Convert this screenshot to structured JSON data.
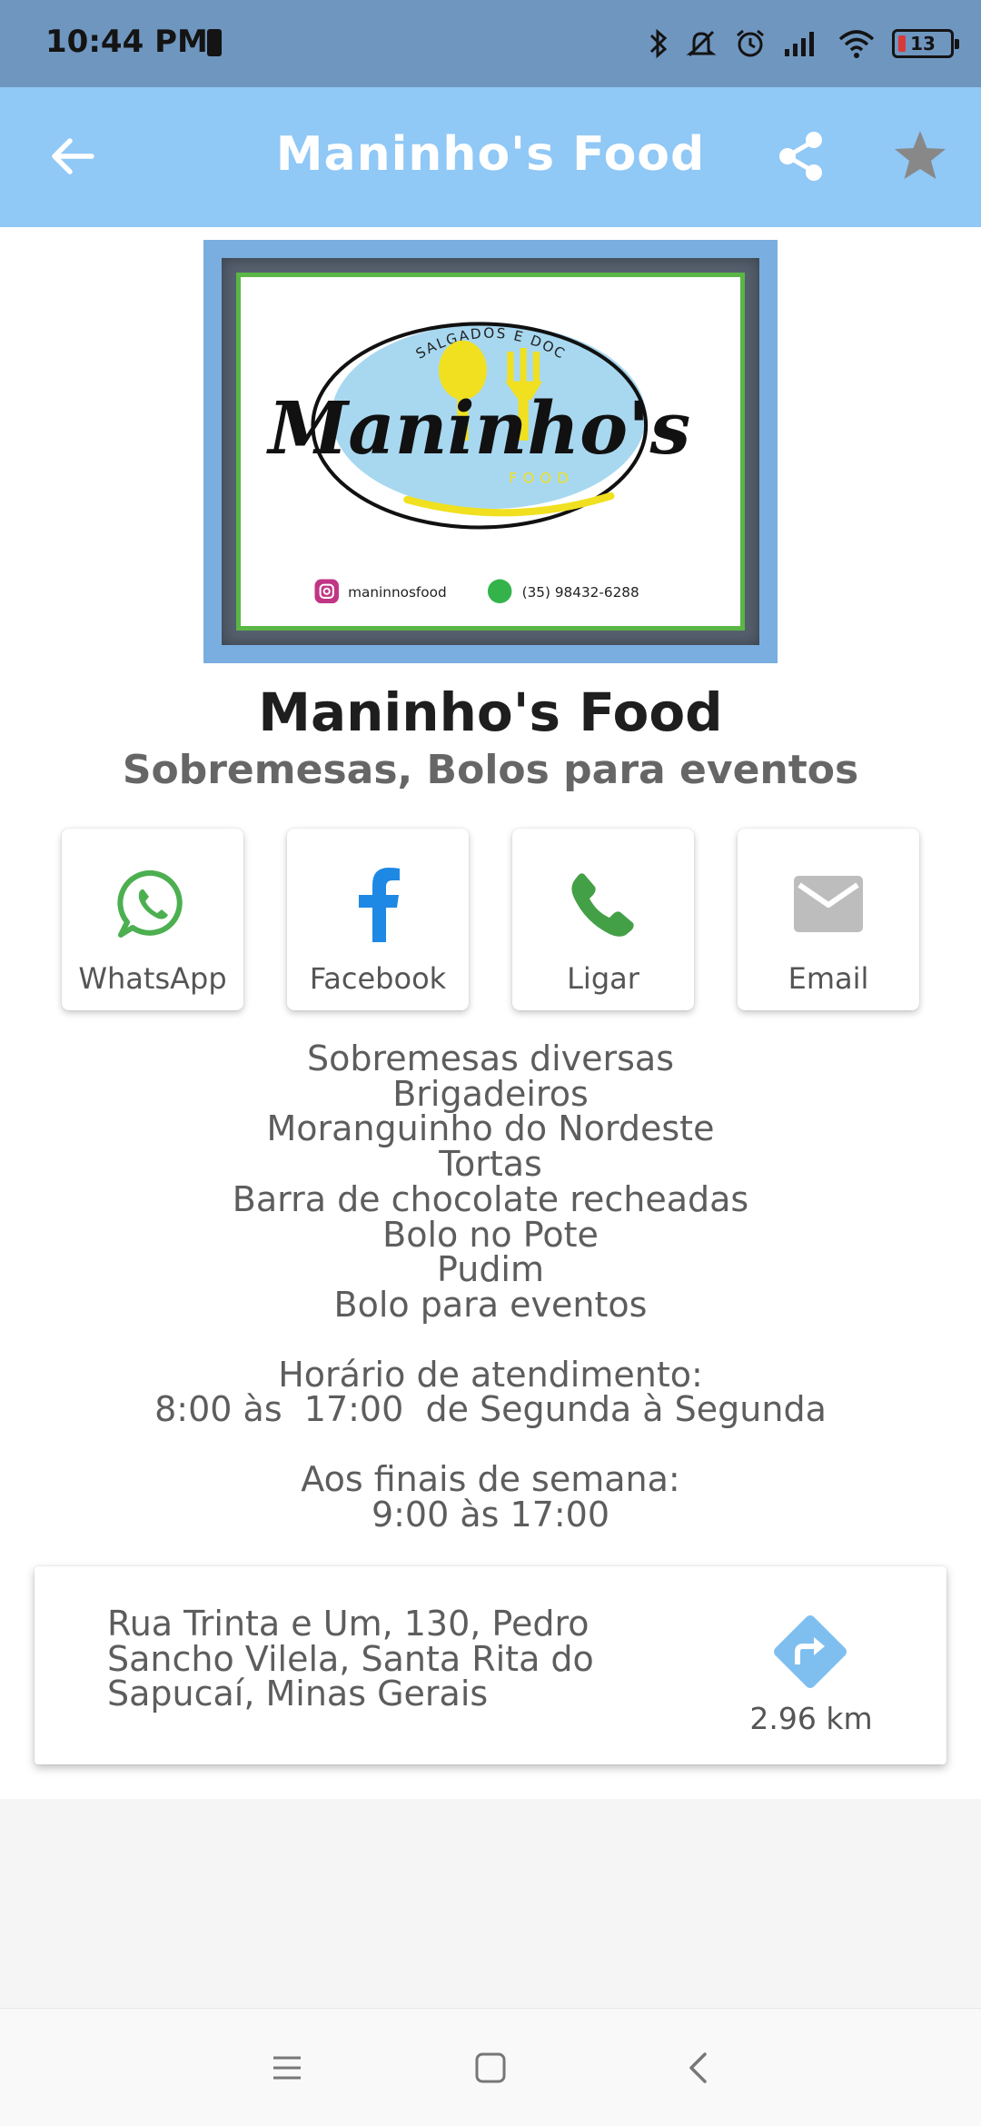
{
  "status_bar": {
    "time": "10:44 PM",
    "battery_level": "13"
  },
  "app_bar": {
    "title": "Maninho's Food",
    "color": "#90c8f6"
  },
  "logo": {
    "top_text": "SALGADOS E DOCES",
    "brand": "Maninho's",
    "brand_sub": "FOOD",
    "instagram": "maninnosfood",
    "phone": "(35) 98432-6288"
  },
  "business": {
    "name": "Maninho's Food",
    "subtitle": "Sobremesas, Bolos para eventos"
  },
  "contacts": [
    {
      "label": "WhatsApp",
      "icon": "whatsapp-icon",
      "color": "#4caf50"
    },
    {
      "label": "Facebook",
      "icon": "facebook-icon",
      "color": "#1e88e5"
    },
    {
      "label": "Ligar",
      "icon": "phone-icon",
      "color": "#43a047"
    },
    {
      "label": "Email",
      "icon": "email-icon",
      "color": "#bdbdbd"
    }
  ],
  "description": {
    "items": [
      "Sobremesas diversas",
      "Brigadeiros",
      "Moranguinho do Nordeste",
      "Tortas",
      "Barra de chocolate recheadas",
      "Bolo no Pote",
      "Pudim",
      "Bolo para eventos"
    ],
    "hours_title": "Horário de atendimento:",
    "hours": "8:00 às  17:00  de Segunda à Segunda",
    "weekend_title": "Aos finais de semana:",
    "weekend_hours": "9:00 às 17:00"
  },
  "address": {
    "line1": "Rua Trinta e Um, 130, Pedro",
    "line2": "Sancho Vilela, Santa Rita do",
    "line3": "Sapucaí, Minas Gerais",
    "distance": "2.96 km"
  }
}
